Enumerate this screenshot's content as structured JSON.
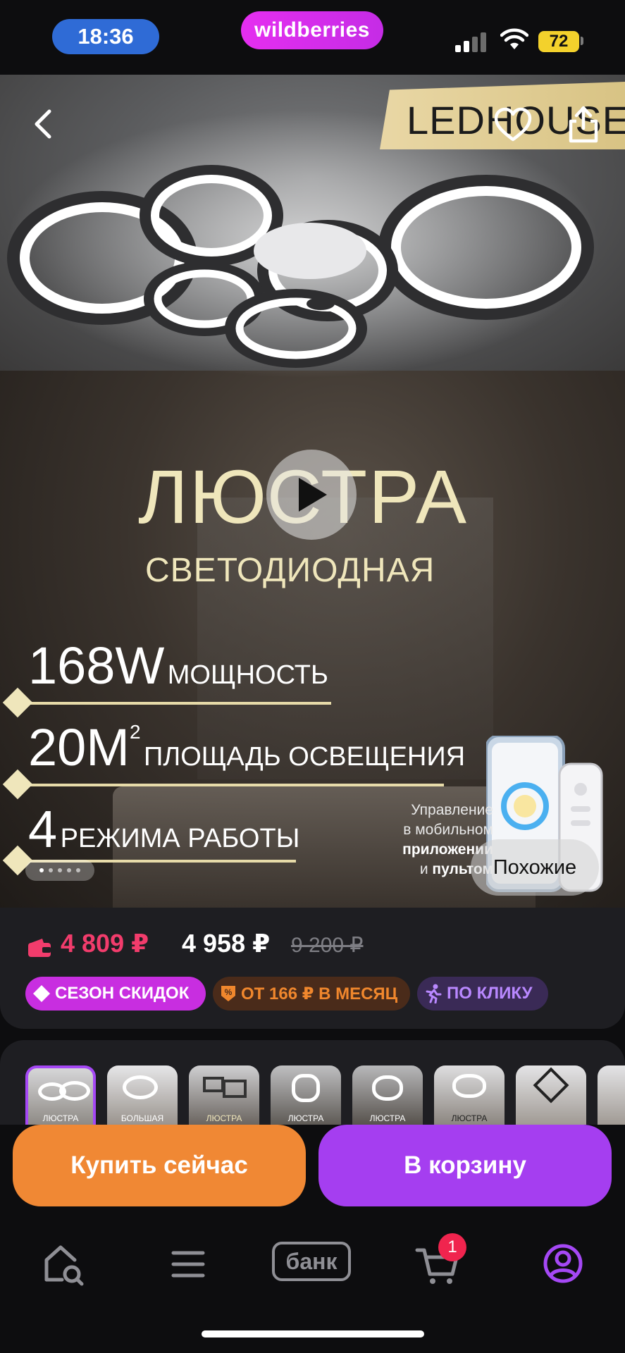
{
  "status_bar": {
    "time": "18:36",
    "brand": "wildberries",
    "battery": "72",
    "colors": {
      "time_pill": "#2f6bd6",
      "brand_pill": "#e52ef0",
      "battery": "#f3d12c"
    }
  },
  "hero": {
    "brand_logo": "LEDHOUSE",
    "title": "ЛЮСТРА",
    "subtitle": "СВЕТОДИОДНАЯ",
    "specs": [
      {
        "value": "168W",
        "label": "МОЩНОСТЬ"
      },
      {
        "value": "20М",
        "sup": "2",
        "label": "ПЛОЩАДЬ ОСВЕЩЕНИЯ"
      },
      {
        "value": "4",
        "label": "РЕЖИМА РАБОТЫ"
      }
    ],
    "control_caption": {
      "line1": "Управление",
      "line2": "в мобильном",
      "line3_bold": "приложении",
      "line4_prefix": "и ",
      "line4_bold": "пультом"
    },
    "similar_label": "Похожие",
    "carousel": {
      "total": 5,
      "active": 1
    },
    "icons": [
      "back-arrow-icon",
      "heart-icon",
      "share-icon",
      "play-icon"
    ]
  },
  "price": {
    "wallet_price": "4 809 ₽",
    "price": "4 958 ₽",
    "old_price": "9 200 ₽",
    "colors": {
      "wallet": "#f23c6c",
      "old": "#7e7e84"
    }
  },
  "badges": [
    {
      "label": "СЕЗОН СКИДОК",
      "icon": "tag-icon",
      "color": "#c82ee0"
    },
    {
      "label": "ОТ 166 ₽ В МЕСЯЦ",
      "icon": "installment-icon",
      "color": "#f0872d"
    },
    {
      "label": "ПО КЛИКУ",
      "icon": "running-person-icon",
      "color": "#b988ff"
    }
  ],
  "thumbnails": [
    {
      "caption": "ЛЮСТРА",
      "selected": true
    },
    {
      "caption": "БОЛЬШАЯ",
      "selected": false
    },
    {
      "caption": "ЛЮСТРА",
      "selected": false
    },
    {
      "caption": "ЛЮСТРА",
      "selected": false
    },
    {
      "caption": "ЛЮСТРА",
      "selected": false
    },
    {
      "caption": "ЛЮСТРА",
      "selected": false
    },
    {
      "caption": "",
      "selected": false
    },
    {
      "caption": "",
      "selected": false
    }
  ],
  "actions": {
    "buy_now": "Купить сейчас",
    "add_to_cart": "В корзину",
    "colors": {
      "buy": "#f08834",
      "cart": "#a53ef0"
    }
  },
  "bottom_nav": {
    "items": [
      "home-search-icon",
      "menu-icon",
      "bank",
      "cart-icon",
      "profile-icon"
    ],
    "bank_label": "банк",
    "cart_count": "1",
    "active": "profile-icon",
    "active_color": "#a548f5"
  }
}
